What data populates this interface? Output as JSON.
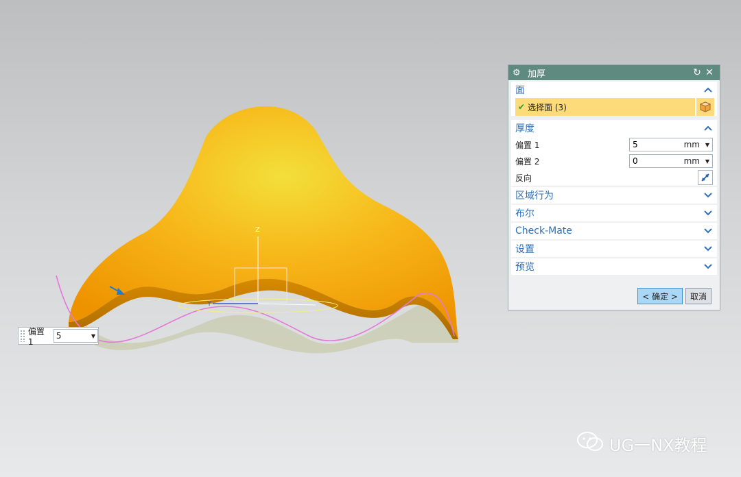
{
  "dialog": {
    "title": "加厚",
    "sections": {
      "face": {
        "label": "面",
        "select_label": "选择面 (3)"
      },
      "thickness": {
        "label": "厚度",
        "offset1": {
          "label": "偏置 1",
          "value": "5",
          "unit": "mm"
        },
        "offset2": {
          "label": "偏置 2",
          "value": "0",
          "unit": "mm"
        },
        "reverse_label": "反向"
      },
      "region": {
        "label": "区域行为"
      },
      "boolean": {
        "label": "布尔"
      },
      "checkmate": {
        "label": "Check-Mate"
      },
      "settings": {
        "label": "设置"
      },
      "preview": {
        "label": "预览"
      }
    },
    "ok_label": "< 确定 >",
    "cancel_label": "取消"
  },
  "viewport": {
    "axis_z": "Z",
    "axis_y": "Y",
    "offset_input": {
      "label": "偏置 1",
      "value": "5"
    }
  },
  "watermark": "UG一NX教程",
  "colors": {
    "title_bar": "#5f8a80",
    "section_text": "#2f6fb5",
    "selection": "#fddb7a",
    "surface": "#f5a300"
  }
}
